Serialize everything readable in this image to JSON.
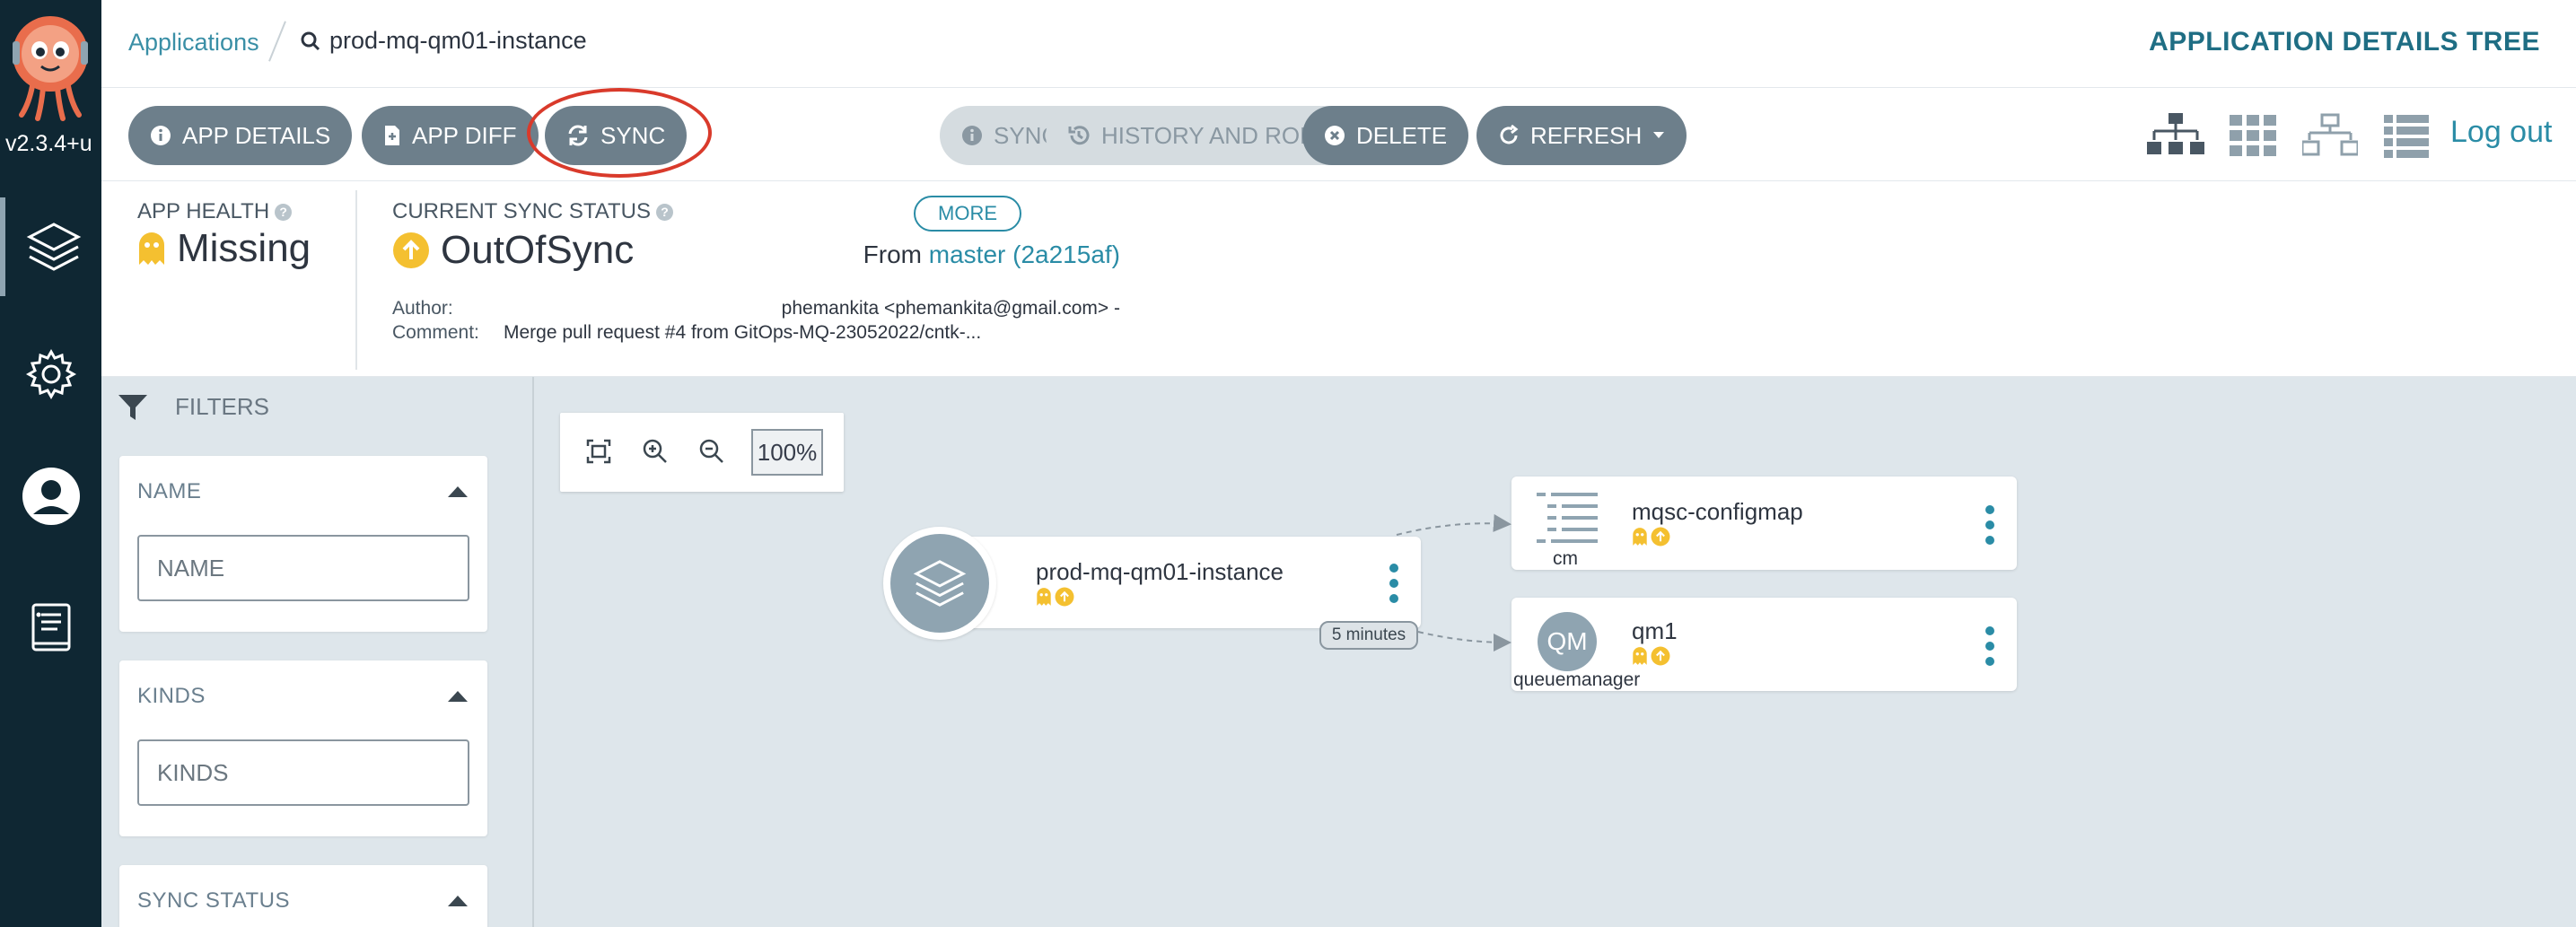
{
  "nav": {
    "version": "v2.3.4+u",
    "items": [
      "applications",
      "settings",
      "user-info",
      "documentation"
    ]
  },
  "header": {
    "breadcrumb_root": "Applications",
    "breadcrumb_current": "prod-mq-qm01-instance",
    "page_mode": "APPLICATION DETAILS TREE"
  },
  "toolbar": {
    "app_details": "APP DETAILS",
    "app_diff": "APP DIFF",
    "sync": "SYNC",
    "sync_status": "SYNC STATUS",
    "history": "HISTORY AND ROLLBACK",
    "delete": "DELETE",
    "refresh": "REFRESH",
    "logout": "Log out"
  },
  "status": {
    "health_label": "APP HEALTH",
    "health_value": "Missing",
    "sync_label": "CURRENT SYNC STATUS",
    "sync_value": "OutOfSync",
    "more": "MORE",
    "from_prefix": "From",
    "from_value": "master (2a215af)",
    "author_label": "Author:",
    "author_value": "phemankita <phemankita@gmail.com> -",
    "comment_label": "Comment:",
    "comment_value": "Merge pull request #4 from GitOps-MQ-23052022/cntk-..."
  },
  "filters": {
    "header": "FILTERS",
    "name_title": "NAME",
    "name_placeholder": "NAME",
    "kinds_title": "KINDS",
    "kinds_placeholder": "KINDS",
    "sync_status_title": "SYNC STATUS"
  },
  "graph": {
    "zoom": "100%",
    "app_node": "prod-mq-qm01-instance",
    "edge_label": "5 minutes",
    "configmap_node": "mqsc-configmap",
    "configmap_kind": "cm",
    "qm_node": "qm1",
    "qm_abbrev": "QM",
    "qm_kind": "queuemanager"
  },
  "colors": {
    "nav_bg": "#0f2733",
    "accent": "#2a8ca6",
    "missing": "#f4c030",
    "outofsync": "#f4c030",
    "button": "#6d7f8b",
    "highlight_ring": "#d93a2b"
  }
}
